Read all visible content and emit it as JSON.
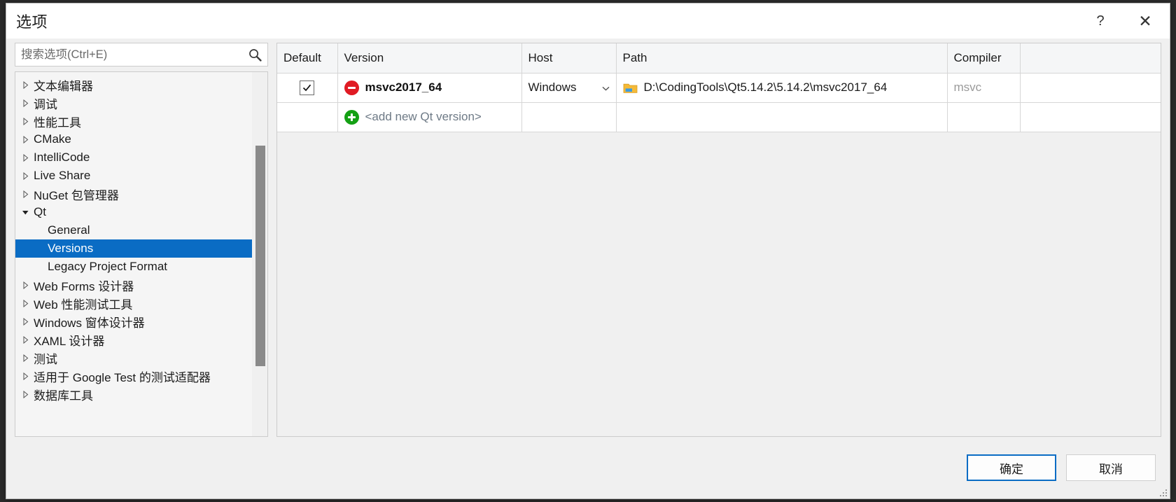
{
  "window": {
    "title": "选项",
    "help_label": "?",
    "close_label": "✕"
  },
  "search": {
    "placeholder": "搜索选项(Ctrl+E)",
    "value": "",
    "icon": "search-icon"
  },
  "sidebar": {
    "items": [
      {
        "label": "文本编辑器",
        "level": 0,
        "expandable": true,
        "expanded": false,
        "selected": false
      },
      {
        "label": "调试",
        "level": 0,
        "expandable": true,
        "expanded": false,
        "selected": false
      },
      {
        "label": "性能工具",
        "level": 0,
        "expandable": true,
        "expanded": false,
        "selected": false
      },
      {
        "label": "CMake",
        "level": 0,
        "expandable": true,
        "expanded": false,
        "selected": false
      },
      {
        "label": "IntelliCode",
        "level": 0,
        "expandable": true,
        "expanded": false,
        "selected": false
      },
      {
        "label": "Live Share",
        "level": 0,
        "expandable": true,
        "expanded": false,
        "selected": false
      },
      {
        "label": "NuGet 包管理器",
        "level": 0,
        "expandable": true,
        "expanded": false,
        "selected": false
      },
      {
        "label": "Qt",
        "level": 0,
        "expandable": true,
        "expanded": true,
        "selected": false
      },
      {
        "label": "General",
        "level": 1,
        "expandable": false,
        "expanded": false,
        "selected": false
      },
      {
        "label": "Versions",
        "level": 1,
        "expandable": false,
        "expanded": false,
        "selected": true
      },
      {
        "label": "Legacy Project Format",
        "level": 1,
        "expandable": false,
        "expanded": false,
        "selected": false
      },
      {
        "label": "Web Forms 设计器",
        "level": 0,
        "expandable": true,
        "expanded": false,
        "selected": false
      },
      {
        "label": "Web 性能测试工具",
        "level": 0,
        "expandable": true,
        "expanded": false,
        "selected": false
      },
      {
        "label": "Windows 窗体设计器",
        "level": 0,
        "expandable": true,
        "expanded": false,
        "selected": false
      },
      {
        "label": "XAML 设计器",
        "level": 0,
        "expandable": true,
        "expanded": false,
        "selected": false
      },
      {
        "label": "测试",
        "level": 0,
        "expandable": true,
        "expanded": false,
        "selected": false
      },
      {
        "label": "适用于 Google Test 的测试适配器",
        "level": 0,
        "expandable": true,
        "expanded": false,
        "selected": false
      },
      {
        "label": "数据库工具",
        "level": 0,
        "expandable": true,
        "expanded": false,
        "selected": false
      }
    ],
    "scrollbar": {
      "name": "sidebar-scrollbar"
    }
  },
  "grid": {
    "columns": [
      {
        "key": "default",
        "label": "Default"
      },
      {
        "key": "version",
        "label": "Version"
      },
      {
        "key": "host",
        "label": "Host"
      },
      {
        "key": "path",
        "label": "Path"
      },
      {
        "key": "compiler",
        "label": "Compiler"
      },
      {
        "key": "extra",
        "label": ""
      }
    ],
    "rows": [
      {
        "default_checked": true,
        "version_icon": "remove-icon",
        "version": "msvc2017_64",
        "host": "Windows",
        "host_chevron": "chevron-down-icon",
        "path_icon": "folder-icon",
        "path": "D:\\CodingTools\\Qt5.14.2\\5.14.2\\msvc2017_64",
        "compiler": "msvc"
      }
    ],
    "add_row": {
      "icon": "add-icon",
      "label": "<add new Qt version>"
    }
  },
  "footer": {
    "ok_label": "确定",
    "cancel_label": "取消"
  },
  "colors": {
    "selection_blue": "#0a6cc4",
    "remove_red": "#e01b24",
    "add_green": "#14a014",
    "folder_yellow": "#f5ba38",
    "panel_bg": "#f0f0f0",
    "disabled_text": "#9a9a9a"
  }
}
